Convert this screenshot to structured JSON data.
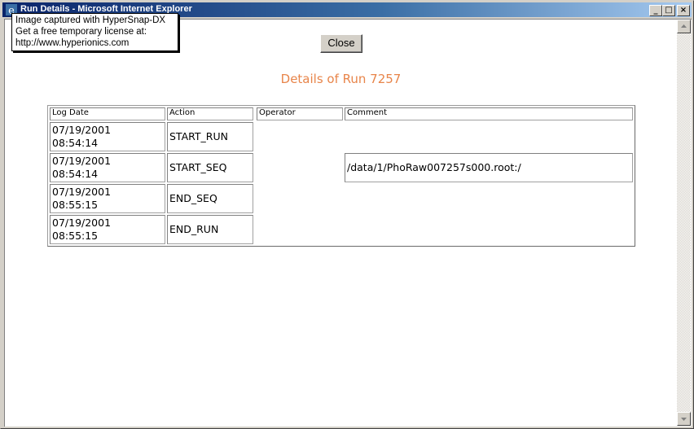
{
  "window": {
    "title": "Run Details - Microsoft Internet Explorer",
    "buttons": {
      "minimize": "_",
      "maximize": "□",
      "close": "×"
    }
  },
  "tooltip": {
    "lines": [
      "Image captured with HyperSnap-DX",
      "Get a free temporary license at:",
      "http://www.hyperionics.com"
    ]
  },
  "page": {
    "close_label": "Close",
    "heading": "Details of Run 7257"
  },
  "table": {
    "headers": [
      "Log Date",
      "Action",
      "Operator",
      "Comment"
    ],
    "rows": [
      {
        "date": "07/19/2001",
        "time": "08:54:14",
        "action": "START_RUN",
        "operator": "",
        "comment": ""
      },
      {
        "date": "07/19/2001",
        "time": "08:54:14",
        "action": "START_SEQ",
        "operator": "",
        "comment": "/data/1/PhoRaw007257s000.root:/"
      },
      {
        "date": "07/19/2001",
        "time": "08:55:15",
        "action": "END_SEQ",
        "operator": "",
        "comment": ""
      },
      {
        "date": "07/19/2001",
        "time": "08:55:15",
        "action": "END_RUN",
        "operator": "",
        "comment": ""
      }
    ]
  },
  "colors": {
    "heading": "#e8854a",
    "titlebar_start": "#0a246a",
    "titlebar_end": "#a6caf0"
  },
  "icons": {
    "title_icon": "ie-icon",
    "scroll_up": "arrow-up-icon",
    "scroll_down": "arrow-down-icon"
  }
}
